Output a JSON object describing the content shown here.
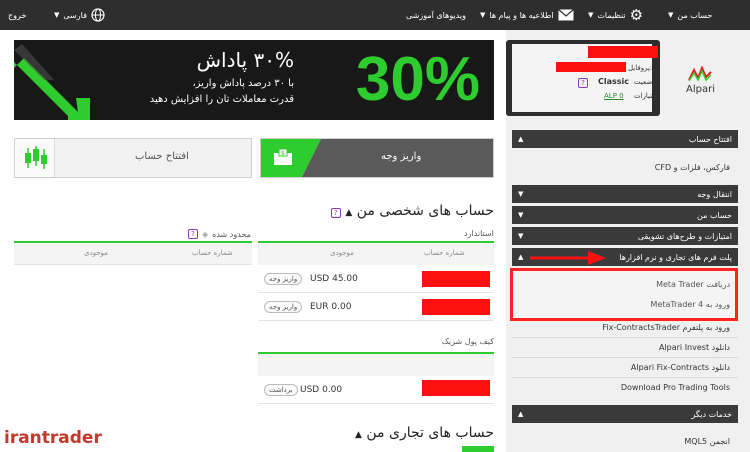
{
  "topbar": {
    "exit": "خروج",
    "language": "فارسی",
    "my_account": "حساب من",
    "settings": "تنظیمات",
    "messages": "اطلاعیه ها و پیام ها",
    "videos": "ویدیوهای آموزشی"
  },
  "profile": {
    "logo": "Alpari",
    "profile_label": "پروفایل:",
    "status_label": "وضعیت:",
    "status_value": "Classic",
    "points_label": "امتیازات:",
    "points_value": "ALP 0"
  },
  "banner": {
    "title": "۳۰% پاداش",
    "line1": "با ۳۰ درصد پاداش واریز،",
    "line2": "قدرت معاملات تان را افزایش دهید",
    "big": "30%"
  },
  "buttons": {
    "open_account": "افتتاح حساب",
    "deposit": "واریز وجه"
  },
  "personal": {
    "title": "حساب های شخصی من",
    "standard": "استاندارد",
    "limited": "محدود شده",
    "col_account": "شماره حساب",
    "col_balance": "موجودی",
    "rows": [
      {
        "amount": "USD 45.00",
        "action": "واریز وجه"
      },
      {
        "amount": "EUR 0.00",
        "action": "واریز وجه"
      }
    ],
    "limited_col_account": "شماره حساب",
    "limited_col_balance": "موجودی"
  },
  "wallet": {
    "title": "کیف پول شریک",
    "row": {
      "amount": "USD 0.00",
      "action": "برداشت"
    }
  },
  "trading": {
    "title": "حساب های تجاری من"
  },
  "sidebar": {
    "open_account": "افتتاح حساب",
    "forex": "فارکس، فلزات و CFD",
    "transfer": "انتقال وجه",
    "my_account": "حساب من",
    "points": "امتیازات و طرح‌های تشویقی",
    "platforms": "پلت فرم های تجاری و نرم افزارها",
    "download_mt": "دریافت Meta Trader",
    "login_mt4": "ورود به MetaTrader 4",
    "fix_login": "ورود به پلتفرم Fix-ContractsTrader",
    "alpari_invest": "دانلود Alpari Invest",
    "alpari_fix": "دانلود Alpari Fix-Contracts",
    "pro_tools": "Download Pro Trading Tools",
    "other": "خدمات دیگر",
    "mql5": "انجمن MQL5"
  },
  "watermark": "irantrader",
  "colors": {
    "accent_green": "#2ecc2e",
    "redaction": "#ff1111",
    "highlight": "#ff2222",
    "dark": "#2e2e2e"
  }
}
